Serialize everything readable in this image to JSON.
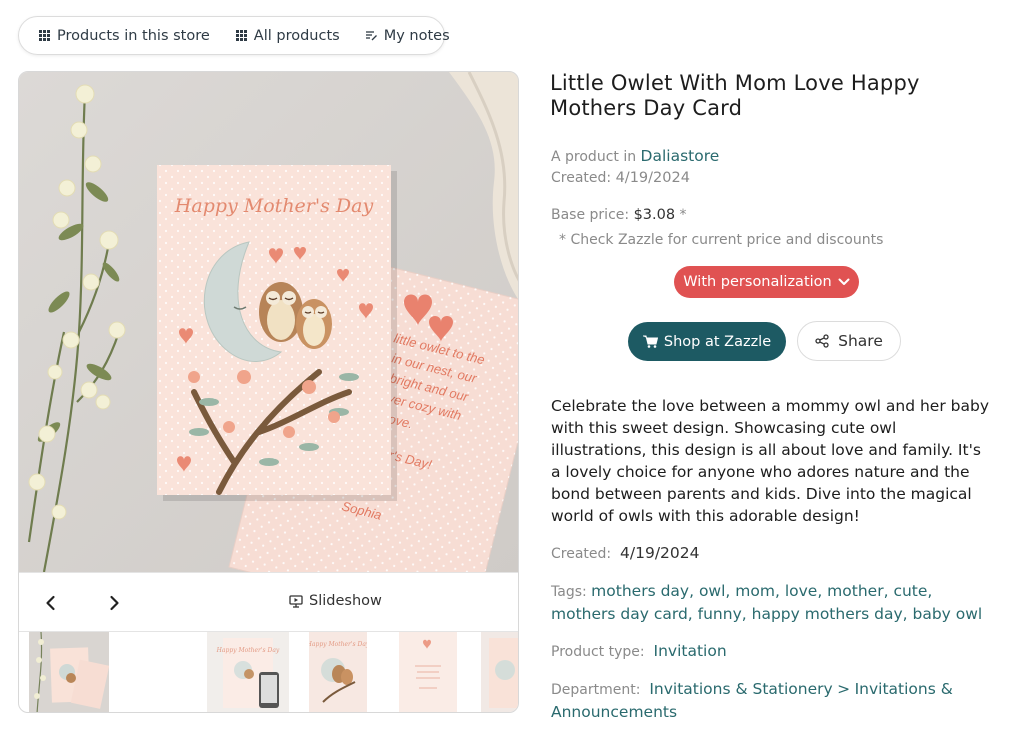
{
  "nav": {
    "products_in_store": "Products in this store",
    "all_products": "All products",
    "my_notes": "My notes"
  },
  "gallery": {
    "slideshow_label": "Slideshow",
    "card_headline": "Happy Mother's Day",
    "card_message": [
      "little owlet to the",
      "in our nest, our",
      "bright and our",
      "ver cozy with",
      "love."
    ],
    "card_closing": "er's Day!",
    "card_signature": "Sophia",
    "thumb_card_headline": "Happy Mother's Day"
  },
  "product": {
    "title": "Little Owlet With Mom Love Happy Mothers Day Card",
    "product_in_label": "A product in",
    "store_name": "Daliastore",
    "created_label": "Created:",
    "created_date": "4/19/2024",
    "base_price_label": "Base price:",
    "base_price": "$3.08",
    "price_asterisk": "*",
    "price_note": "* Check Zazzle for current price and discounts",
    "personalization_label": "With personalization",
    "shop_label": "Shop at Zazzle",
    "share_label": "Share",
    "description": "Celebrate the love between a mommy owl and her baby with this sweet design. Showcasing cute owl illustrations, this design is all about love and family. It's a lovely choice for anyone who adores nature and the bond between parents and kids. Dive into the magical world of owls with this adorable design!",
    "created2_label": "Created:",
    "created2_date": "4/19/2024",
    "tags_label": "Tags:",
    "tags": [
      "mothers day",
      "owl",
      "mom",
      "love",
      "mother",
      "cute",
      "mothers day card",
      "funny",
      "happy mothers day",
      "baby owl"
    ],
    "product_type_label": "Product type:",
    "product_type": "Invitation",
    "department_label": "Department:",
    "department": "Invitations & Stationery",
    "department_sep": ">",
    "subdepartment": "Invitations & Announcements"
  },
  "colors": {
    "accent_red": "#e05252",
    "teal_button": "#1d5a63",
    "link_teal": "#2a6a6e"
  }
}
